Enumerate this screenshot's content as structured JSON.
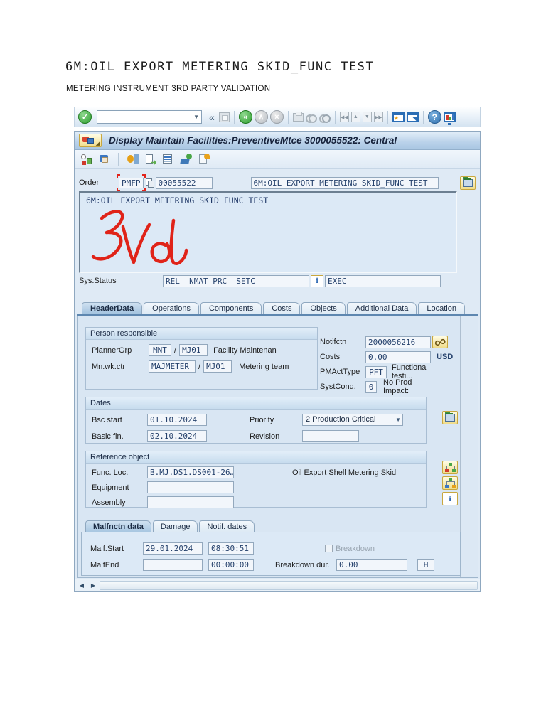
{
  "colors": {
    "annotation_red": "#e02318",
    "titlebar_blue": "#aac6e2",
    "panel_blue": "#d9e6f3",
    "enter_green": "#2e9e2e",
    "accent_blue": "#2a6db5",
    "field_text_navy": "#24406b"
  },
  "icons": {
    "enter_glyph": "✓",
    "collapse_glyph": "«",
    "back_glyph": "«",
    "exit_glyph": "∧",
    "cancel_glyph": "×",
    "dropdown_glyph": "▼",
    "help_glyph": "?",
    "info_glyph": "i",
    "star_glyph": "★",
    "shortcut_glyph": "◥",
    "page_first_glyph": "◀◀",
    "page_prev_glyph": "▲",
    "page_next_glyph": "▼",
    "page_last_glyph": "▶▶",
    "scroll_left_glyph": "◀",
    "scroll_right_glyph": "▶"
  },
  "doc": {
    "title": "6M:OIL EXPORT METERING SKID_FUNC TEST",
    "subtitle": "METERING INSTRUMENT 3RD PARTY VALIDATION"
  },
  "toolbar": {
    "command_value": ""
  },
  "window": {
    "title": "Display Maintain Facilities:PreventiveMtce 3000055522: Central"
  },
  "order": {
    "label": "Order",
    "type_value": "PMFP",
    "number_value": "00055522",
    "description": "6M:OIL EXPORT METERING SKID_FUNC TEST"
  },
  "longtext": {
    "line1": "6M:OIL EXPORT METERING SKID_FUNC TEST"
  },
  "sys_status": {
    "label": "Sys.Status",
    "value": "REL  NMAT PRC  SETC",
    "user_status": "EXEC"
  },
  "tabs": {
    "items": [
      "HeaderData",
      "Operations",
      "Components",
      "Costs",
      "Objects",
      "Additional Data",
      "Location"
    ],
    "active": "HeaderData"
  },
  "person": {
    "title": "Person responsible",
    "planner_label": "PlannerGrp",
    "planner_value": "MNT",
    "sep": "/",
    "planner_plant": "MJ01",
    "planner_desc": "Facility Maintenan",
    "wkctr_label": "Mn.wk.ctr",
    "wkctr_value": "MAJMETER",
    "wkctr_plant": "MJ01",
    "wkctr_desc": "Metering team"
  },
  "header_fields": {
    "notif_label": "Notifctn",
    "notif_value": "2000056216",
    "costs_label": "Costs",
    "costs_value": "0.00",
    "costs_unit": "USD",
    "pmact_label": "PMActType",
    "pmact_value": "PFT",
    "pmact_desc": "Functional testi...",
    "systcond_label": "SystCond.",
    "systcond_value": "0",
    "systcond_desc": "No Prod Impact:"
  },
  "dates": {
    "title": "Dates",
    "bsc_label": "Bsc start",
    "bsc_value": "01.10.2024",
    "fin_label": "Basic fin.",
    "fin_value": "02.10.2024",
    "priority_label": "Priority",
    "priority_value": "2 Production Critical",
    "revision_label": "Revision",
    "revision_value": ""
  },
  "reference": {
    "title": "Reference object",
    "funcloc_label": "Func. Loc.",
    "funcloc_value": "B.MJ.DS1.DS001-26…",
    "funcloc_desc": "Oil Export Shell Metering Skid",
    "equipment_label": "Equipment",
    "equipment_value": "",
    "assembly_label": "Assembly",
    "assembly_value": ""
  },
  "malfunction": {
    "tabs": [
      "Malfnctn data",
      "Damage",
      "Notif. dates"
    ],
    "active_tab": "Malfnctn data",
    "start_label": "Malf.Start",
    "start_date": "29.01.2024",
    "start_time": "08:30:51",
    "end_label": "MalfEnd",
    "end_date": "",
    "end_time": "00:00:00",
    "breakdown_label": "Breakdown",
    "duration_label": "Breakdown dur.",
    "duration_value": "0.00",
    "duration_unit": "H"
  }
}
